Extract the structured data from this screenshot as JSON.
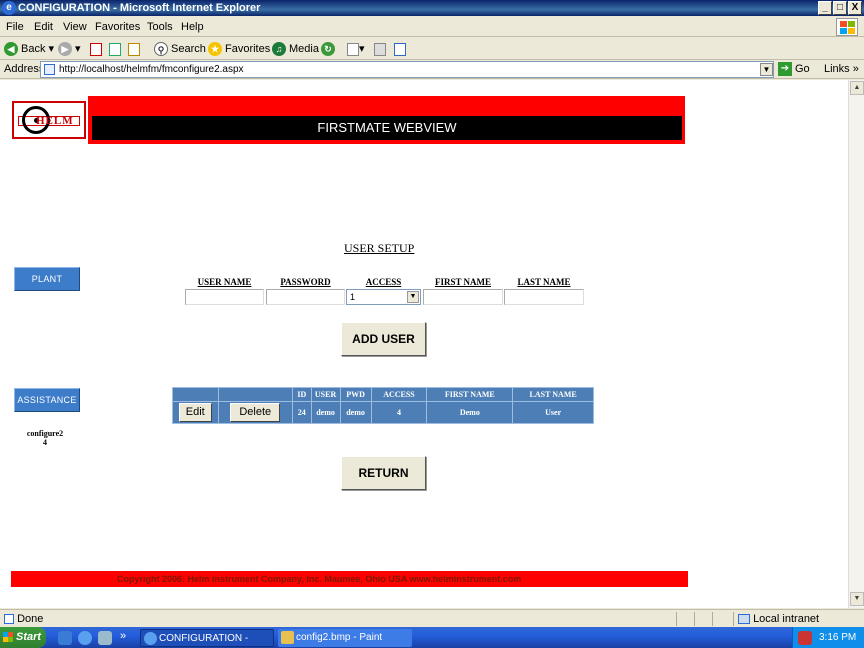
{
  "window": {
    "title": "CONFIGURATION - Microsoft Internet Explorer",
    "controls": {
      "minimize": "_",
      "maximize": "□",
      "close": "X"
    }
  },
  "menu": [
    "File",
    "Edit",
    "View",
    "Favorites",
    "Tools",
    "Help"
  ],
  "toolbar": {
    "back": "Back",
    "search": "Search",
    "favorites": "Favorites",
    "media": "Media"
  },
  "address": {
    "label": "Address",
    "url": "http://localhost/helmfm/fmconfigure2.aspx",
    "go": "Go",
    "links": "Links"
  },
  "page": {
    "logo_text": "HELM",
    "header_title": "FIRSTMATE WEBVIEW",
    "nav": {
      "plant_floor": "PLANT FLOOR",
      "assistance": "ASSISTANCE"
    },
    "config_info": {
      "name": "configure2",
      "value": "4"
    },
    "user_setup": {
      "title": "USER SETUP",
      "columns": [
        "USER NAME",
        "PASSWORD",
        "ACCESS",
        "FIRST NAME",
        "LAST NAME"
      ],
      "access_value": "1",
      "add_button": "ADD USER"
    },
    "grid": {
      "headers": [
        "",
        "",
        "ID",
        "USER",
        "PWD",
        "ACCESS",
        "FIRST NAME",
        "LAST NAME"
      ],
      "rows": [
        {
          "edit": "Edit",
          "delete": "Delete",
          "id": "24",
          "user": "demo",
          "pwd": "demo",
          "access": "4",
          "first": "Demo",
          "last": "User"
        }
      ]
    },
    "return_button": "RETURN",
    "footer": "Copyright 2006: Helm Instrument Company, Inc.   Maumee, Ohio USA   www.helminstrument.com"
  },
  "status": {
    "text": "Done",
    "zone": "Local intranet"
  },
  "taskbar": {
    "start": "Start",
    "tasks": [
      "CONFIGURATION - Mic...",
      "config2.bmp - Paint"
    ],
    "chevron": "»",
    "clock": "3:16 PM"
  },
  "colors": {
    "header_red": "#ff0000",
    "nav_blue": "#3d7cc9",
    "grid_blue": "#4d7fb6"
  }
}
